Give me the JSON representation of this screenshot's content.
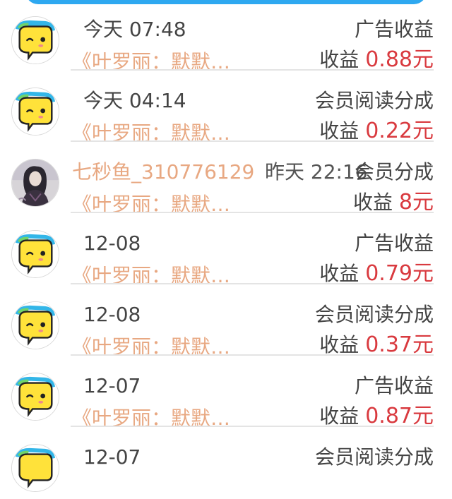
{
  "colors": {
    "accent_blue": "#2ea8f0",
    "book_title": "#e8a882",
    "amount_red": "#d93a3f",
    "text": "#444444"
  },
  "records": [
    {
      "time": "今天 07:48",
      "user_name": "",
      "type": "广告收益",
      "book": "《叶罗丽：默默…",
      "earning_label": "收益",
      "amount": "0.88元",
      "avatar": "yellow-chat-icon"
    },
    {
      "time": "今天 04:14",
      "user_name": "",
      "type": "会员阅读分成",
      "book": "《叶罗丽：默默…",
      "earning_label": "收益",
      "amount": "0.22元",
      "avatar": "yellow-chat-icon"
    },
    {
      "time": "昨天 22:16",
      "user_name": "七秒鱼_310776129",
      "type": "会员分成",
      "book": "《叶罗丽：默默…",
      "earning_label": "收益",
      "amount": "8元",
      "avatar": "user-photo"
    },
    {
      "time": "12-08",
      "user_name": "",
      "type": "广告收益",
      "book": "《叶罗丽：默默…",
      "earning_label": "收益",
      "amount": "0.79元",
      "avatar": "yellow-chat-icon"
    },
    {
      "time": "12-08",
      "user_name": "",
      "type": "会员阅读分成",
      "book": "《叶罗丽：默默…",
      "earning_label": "收益",
      "amount": "0.37元",
      "avatar": "yellow-chat-icon"
    },
    {
      "time": "12-07",
      "user_name": "",
      "type": "广告收益",
      "book": "《叶罗丽：默默…",
      "earning_label": "收益",
      "amount": "0.87元",
      "avatar": "yellow-chat-icon"
    },
    {
      "time": "12-07",
      "user_name": "",
      "type": "会员阅读分成",
      "book": "",
      "earning_label": "",
      "amount": "",
      "avatar": "yellow-chat-icon"
    }
  ]
}
